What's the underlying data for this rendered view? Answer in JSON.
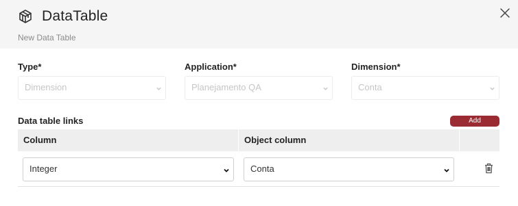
{
  "header": {
    "title": "DataTable",
    "subtitle": "New Data Table",
    "icon": "cube-icon",
    "close_icon": "close-icon"
  },
  "form": {
    "type": {
      "label": "Type*",
      "value": "Dimension"
    },
    "application": {
      "label": "Application*",
      "value": "Planejamento QA"
    },
    "dimension": {
      "label": "Dimension*",
      "value": "Conta"
    }
  },
  "links": {
    "title": "Data table links",
    "add_label": "Add",
    "columns": [
      "Column",
      "Object column"
    ],
    "rows": [
      {
        "column": "Integer",
        "object_column": "Conta"
      }
    ]
  },
  "colors": {
    "accent": "#9b2b33",
    "header_bg": "#f5f5f5",
    "table_head_bg": "#eeeeee"
  }
}
